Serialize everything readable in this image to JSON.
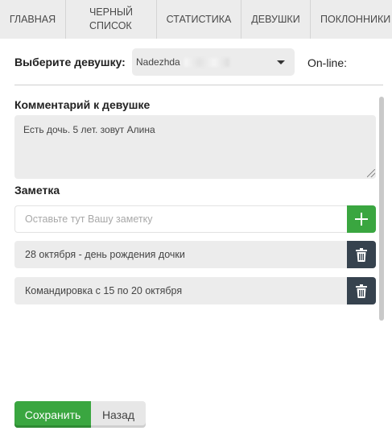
{
  "nav": {
    "items": [
      {
        "label": "ГЛАВНАЯ"
      },
      {
        "label_line1": "ЧЕРНЫЙ",
        "label_line2": "СПИСОК"
      },
      {
        "label": "СТАТИСТИКА"
      },
      {
        "label": "ДЕВУШКИ"
      },
      {
        "label": "ПОКЛОННИКИ"
      }
    ]
  },
  "selector": {
    "label": "Выберите девушку:",
    "value": "Nadezhda",
    "online_label": "On-line:"
  },
  "comment": {
    "title": "Комментарий к девушке",
    "value": "Есть дочь. 5 лет. зовут Алина"
  },
  "notes": {
    "title": "Заметка",
    "placeholder": "Оставьте тут Вашу заметку",
    "items": [
      {
        "text": "28 октября - день рождения дочки"
      },
      {
        "text": "Командировка с 15 по 20 октября"
      }
    ]
  },
  "actions": {
    "save_label": "Сохранить",
    "back_label": "Назад"
  },
  "colors": {
    "accent_green": "#3aa640",
    "delete_dark": "#36424e",
    "nav_bg": "#ececec"
  },
  "icons": {
    "add": "plus-icon",
    "delete": "trash-icon",
    "dropdown": "caret-down-icon"
  }
}
